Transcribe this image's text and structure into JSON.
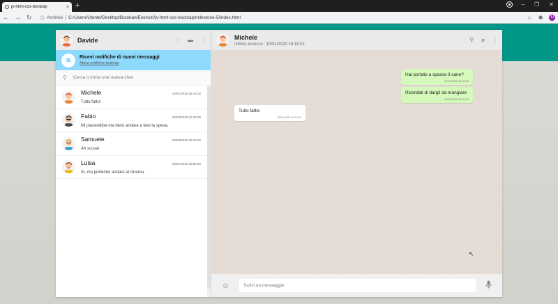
{
  "browser": {
    "tab_title": "js-html-css-boolzap",
    "tab_close": "×",
    "new_tab": "+",
    "archivio_label": "Archivio",
    "url": "C:/Users/Utente/Desktop/Boolean/Esercizi/js-html-css-boolzap/milestone-5/index.html",
    "profile_initial": "U",
    "back_glyph": "←",
    "forward_glyph": "→",
    "reload_glyph": "↻",
    "minimize_glyph": "–",
    "maximize_glyph": "❐",
    "close_glyph": "✕"
  },
  "user": {
    "name": "Davide"
  },
  "notification": {
    "title": "Ricevi notifiche di nuovi messaggi",
    "link": "Attiva notifiche desktop"
  },
  "search": {
    "placeholder": "Cerca o inizia una nuova chat"
  },
  "chats": [
    {
      "name": "Michele",
      "time": "10/01/2020 16:15:22",
      "last": "Tutto fatto!"
    },
    {
      "name": "Fabio",
      "time": "20/03/2020 16:35:00",
      "last": "Mi piacerebbe ma devo andare a fare la spesa."
    },
    {
      "name": "Samuele",
      "time": "28/03/2020 16:15:22",
      "last": "Ah scusa!"
    },
    {
      "name": "Luisa",
      "time": "10/01/2020 15:50:00",
      "last": "Si, ma preferirei andare al cinema"
    }
  ],
  "conversation": {
    "contact_name": "Michele",
    "last_seen": "Ultimo accesso : 10/01/2020 16:15:22",
    "messages": [
      {
        "text": "Hai portato a spasso il cane?",
        "time": "10/01/2020 15:30:55",
        "type": "sent"
      },
      {
        "text": "Ricordati di dargli da mangiare",
        "time": "10/01/2020 15:50:00",
        "type": "sent"
      },
      {
        "text": "Tutto fatto!",
        "time": "10/01/2020 16:15:22",
        "type": "received"
      }
    ]
  },
  "composer": {
    "placeholder": "Scrivi un messaggio"
  },
  "colors": {
    "header_band": "#009688",
    "notification_bg": "#8edafc",
    "sent_bubble": "#d5f9ba",
    "received_bubble": "#ffffff"
  }
}
